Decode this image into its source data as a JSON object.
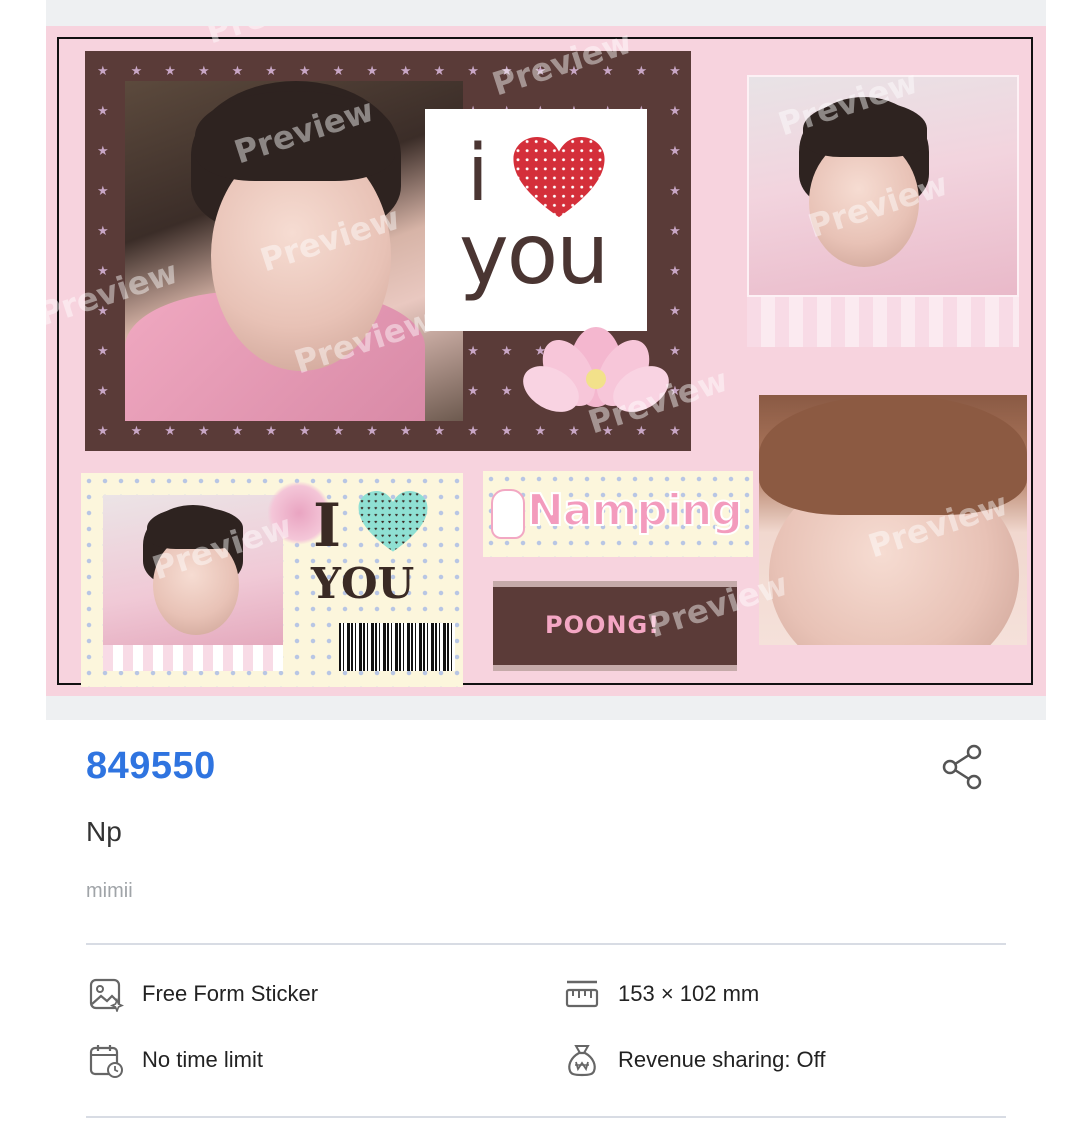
{
  "design": {
    "watermark": "Preview",
    "main_card": {
      "letter_i": "i",
      "word_you": "you"
    },
    "cream_card": {
      "letter_i": "I",
      "word_you": "YOU"
    },
    "namping_text": "Namping",
    "poong_text": "POONG!"
  },
  "product": {
    "id": "849550",
    "title": "Np",
    "author": "mimii",
    "share_icon": "share-icon"
  },
  "specs": {
    "type": "Free Form Sticker",
    "size": "153 × 102 mm",
    "time_limit": "No time limit",
    "revenue": "Revenue sharing: Off"
  },
  "colors": {
    "accent_blue": "#2f74e0",
    "canvas_pink": "#f7d3de",
    "panel_brown": "#5a3b38"
  }
}
